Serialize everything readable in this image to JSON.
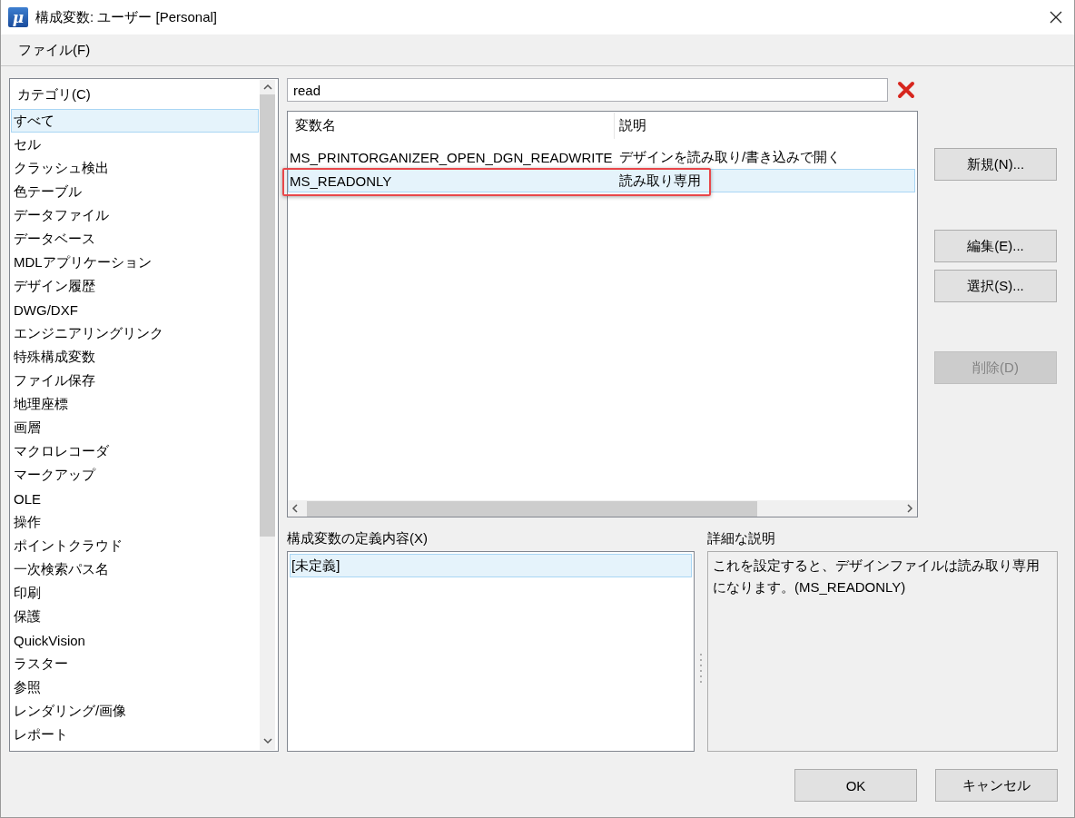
{
  "window": {
    "title": "構成変数: ユーザー [Personal]",
    "app_icon_glyph": "μ"
  },
  "menu": [
    {
      "label": "ファイル(F)"
    }
  ],
  "category_list": {
    "header": "カテゴリ(C)",
    "items": [
      {
        "label": "すべて",
        "selected": true
      },
      {
        "label": "セル",
        "selected": false
      },
      {
        "label": "クラッシュ検出",
        "selected": false
      },
      {
        "label": "色テーブル",
        "selected": false
      },
      {
        "label": "データファイル",
        "selected": false
      },
      {
        "label": "データベース",
        "selected": false
      },
      {
        "label": "MDLアプリケーション",
        "selected": false
      },
      {
        "label": "デザイン履歴",
        "selected": false
      },
      {
        "label": "DWG/DXF",
        "selected": false
      },
      {
        "label": "エンジニアリングリンク",
        "selected": false
      },
      {
        "label": "特殊構成変数",
        "selected": false
      },
      {
        "label": "ファイル保存",
        "selected": false
      },
      {
        "label": "地理座標",
        "selected": false
      },
      {
        "label": "画層",
        "selected": false
      },
      {
        "label": "マクロレコーダ",
        "selected": false
      },
      {
        "label": "マークアップ",
        "selected": false
      },
      {
        "label": "OLE",
        "selected": false
      },
      {
        "label": "操作",
        "selected": false
      },
      {
        "label": "ポイントクラウド",
        "selected": false
      },
      {
        "label": "一次検索パス名",
        "selected": false
      },
      {
        "label": "印刷",
        "selected": false
      },
      {
        "label": "保護",
        "selected": false
      },
      {
        "label": "QuickVision",
        "selected": false
      },
      {
        "label": "ラスター",
        "selected": false
      },
      {
        "label": "参照",
        "selected": false
      },
      {
        "label": "レンダリング/画像",
        "selected": false
      },
      {
        "label": "レポート",
        "selected": false
      }
    ]
  },
  "search": {
    "value": "read"
  },
  "variables_table": {
    "columns": [
      "変数名",
      "説明"
    ],
    "rows": [
      {
        "cells": [
          "MS_PRINTORGANIZER_OPEN_DGN_READWRITE",
          "デザインを読み取り/書き込みで開く"
        ],
        "selected": false,
        "highlighted": false
      },
      {
        "cells": [
          "MS_READONLY",
          "読み取り専用"
        ],
        "selected": true,
        "highlighted": true
      }
    ]
  },
  "side_buttons": [
    {
      "label": "新規(N)...",
      "disabled": false
    },
    {
      "label": "編集(E)...",
      "disabled": false
    },
    {
      "label": "選択(S)...",
      "disabled": false
    },
    {
      "label": "削除(D)",
      "disabled": true
    }
  ],
  "definition": {
    "label": "構成変数の定義内容(X)",
    "items": [
      {
        "label": "[未定義]",
        "selected": true
      }
    ]
  },
  "details": {
    "label": "詳細な説明",
    "text": "これを設定すると、デザインファイルは読み取り専用になります。(MS_READONLY)"
  },
  "footer_buttons": [
    {
      "label": "OK"
    },
    {
      "label": "キャンセル"
    }
  ]
}
